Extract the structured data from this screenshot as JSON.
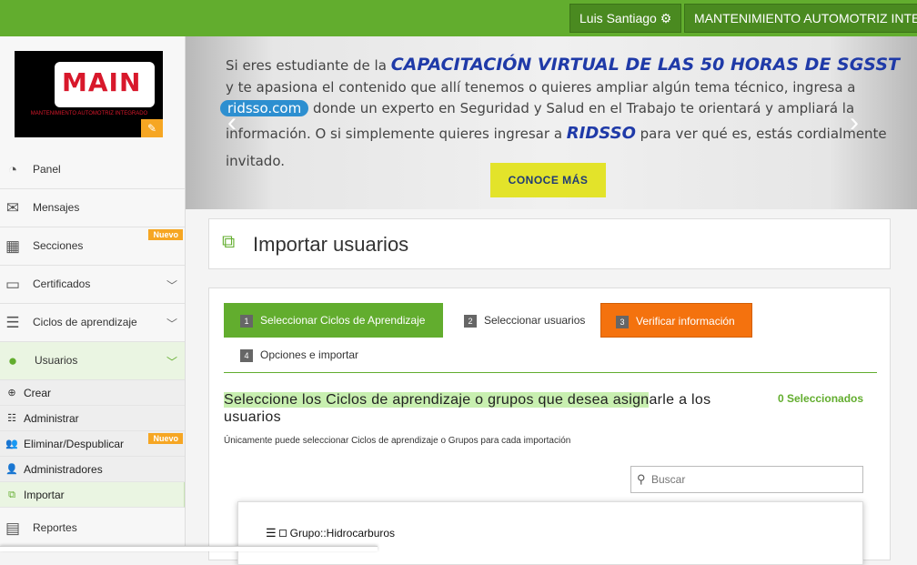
{
  "header": {
    "user_name": "Luis Santiago",
    "user_icon": "gear-icon",
    "company": "MANTENIMIENTO AUTOMOTRIZ INTEGRADO",
    "brand_color": "#62ad2e"
  },
  "logo": {
    "text": "MAIN",
    "subtitle": "MANTENIMIENTO AUTOMOTRIZ INTEGRADO",
    "edit_icon": "edit-icon"
  },
  "sidebar": {
    "items": [
      {
        "label": "Panel",
        "icon": "dashboard-icon"
      },
      {
        "label": "Mensajes",
        "icon": "envelope-icon"
      },
      {
        "label": "Secciones",
        "icon": "grid-icon",
        "badge": "Nuevo"
      },
      {
        "label": "Certificados",
        "icon": "card-icon"
      },
      {
        "label": "Ciclos de aprendizaje",
        "icon": "server-icon"
      },
      {
        "label": "Usuarios",
        "icon": "user-icon"
      }
    ],
    "sub_items": [
      {
        "label": "Crear",
        "icon": "plus-circle-icon"
      },
      {
        "label": "Administrar",
        "icon": "list-icon"
      },
      {
        "label": "Eliminar/Despublicar",
        "icon": "users-icon",
        "badge": "Nuevo"
      },
      {
        "label": "Administradores",
        "icon": "user-icon"
      },
      {
        "label": "Importar",
        "icon": "import-icon"
      }
    ],
    "after_items": [
      {
        "label": "Reportes",
        "icon": "file-icon"
      }
    ]
  },
  "banner": {
    "line1_prefix": "Si eres estudiante de la ",
    "headline": "CAPACITACIÓN VIRTUAL DE LAS 50 HORAS DE SGSST",
    "line2": "y te apasiona el contenido que allí tenemos o quieres ampliar algún tema técnico, ingresa a",
    "pill": "ridsso.com",
    "line3": " donde un experto en Seguridad y Salud en el Trabajo te orientará y ampliará la",
    "line4_prefix": "información. O si simplemente quieres ingresar a ",
    "brand": "RIDSSO",
    "line4_suffix": " para ver qué es, estás cordialmente",
    "line5": "invitado.",
    "cta": "CONOCE MÁS"
  },
  "page": {
    "title": "Importar usuarios",
    "title_icon": "external-link-icon"
  },
  "wizard": {
    "steps": [
      {
        "num": "1",
        "label": "Seleccionar Ciclos de Aprendizaje"
      },
      {
        "num": "2",
        "label": "Seleccionar usuarios"
      },
      {
        "num": "3",
        "label": "Verificar información"
      },
      {
        "num": "4",
        "label": "Opciones e importar"
      }
    ],
    "prompt_hl": "Seleccione los Ciclos de aprendizaje o grupos que desea asign",
    "prompt_rest": "arle a los usuarios",
    "selected": "0 Seleccionados",
    "hint": "Únicamente puede seleccionar Ciclos de aprendizaje o Grupos para cada importación",
    "search_placeholder": "Buscar",
    "tree_item": "Grupo::Hidrocarburos"
  }
}
